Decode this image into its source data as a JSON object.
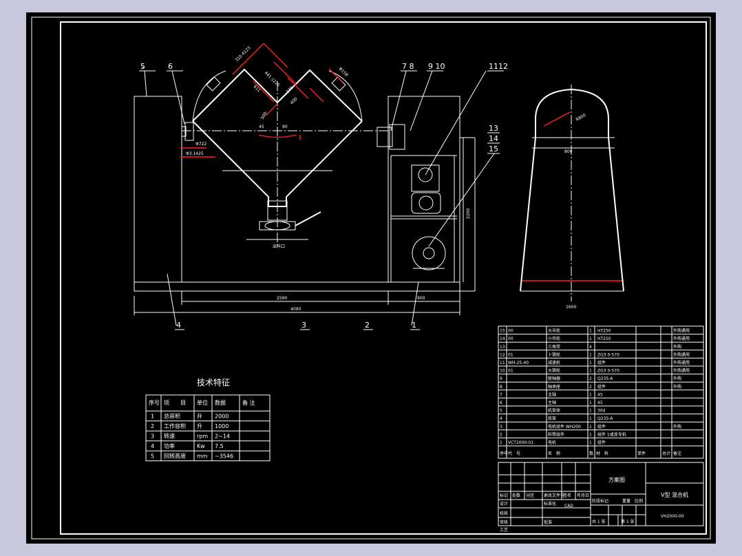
{
  "colors": {
    "background": "#000000",
    "line": "#ffffff",
    "dimension": "#ff2020",
    "outer": "#c8c8dc"
  },
  "balloons": [
    "5",
    "6",
    "7",
    "8",
    "9",
    "10",
    "1112",
    "13",
    "14",
    "15",
    "4",
    "3",
    "2",
    "1"
  ],
  "dims": {
    "d1": "310.4123",
    "d2": "441.1226",
    "d3": "611",
    "d4": "370",
    "d5": "400",
    "d6": "Φ158",
    "d7": "500",
    "d8": "90",
    "d9": "45",
    "d10": "Φ722",
    "d11": "Φ3.1425",
    "d12": "2200",
    "d13": "2590",
    "d14": "900",
    "d15": "4090",
    "d16": "R800",
    "d17": "800",
    "d18": "1600"
  },
  "outlet_label": "出料口",
  "tech": {
    "title": "技术特征",
    "headers": [
      "序号",
      "项　　目",
      "单位",
      "数据",
      "备 注"
    ],
    "rows": [
      [
        "1",
        "总容积",
        "升",
        "2000",
        ""
      ],
      [
        "2",
        "工作容积",
        "升",
        "1000",
        ""
      ],
      [
        "3",
        "转速",
        "rpm",
        "2~14",
        ""
      ],
      [
        "4",
        "功率",
        "Kw",
        "7.5",
        ""
      ],
      [
        "5",
        "回转高度",
        "mm",
        "~3546",
        ""
      ]
    ]
  },
  "bom": {
    "rows": [
      [
        "15",
        "00",
        "大吊轮",
        "1",
        "HT250",
        "",
        "外购通用"
      ],
      [
        "14",
        "00",
        "小吊轮",
        "1",
        "HT250",
        "",
        "外购通用"
      ],
      [
        "13",
        "",
        "三角带",
        "4",
        "",
        "",
        "外购"
      ],
      [
        "12",
        "01",
        "卜铸轮",
        "1",
        "ZG3 0-570",
        "",
        "外购通用"
      ],
      [
        "11",
        "WH-25-40",
        "减速机",
        "1",
        "组件",
        "",
        "外购通用"
      ],
      [
        "10",
        "01",
        "大铸轮",
        "1",
        "ZG3 0-570",
        "",
        "外购通用"
      ],
      [
        "9",
        "",
        "联轴器",
        "2",
        "Q235-A",
        "",
        "外购"
      ],
      [
        "8",
        "",
        "轴承座",
        "2",
        "组件",
        "",
        "外购"
      ],
      [
        "7",
        "",
        "主轴",
        "1",
        "45",
        "",
        ""
      ],
      [
        "6",
        "",
        "主轴",
        "1",
        "45",
        "",
        ""
      ],
      [
        "5",
        "",
        "机架体",
        "1",
        "304",
        "",
        ""
      ],
      [
        "4",
        "",
        "底架",
        "1",
        "Q235-A",
        "",
        ""
      ],
      [
        "3",
        "",
        "电机组件 WH200",
        "1",
        "组件",
        "",
        "外购"
      ],
      [
        "2",
        "",
        "料筒组件",
        "1",
        "组件 1或非专机",
        "",
        ""
      ],
      [
        "1",
        "VCT2000-01",
        "电机",
        "1",
        "组件",
        "",
        ""
      ]
    ],
    "header": [
      "序号",
      "代　号",
      "名　称",
      "数",
      "材　料",
      "单件",
      "总计",
      "备注"
    ],
    "header_sub": [
      "",
      "",
      "",
      "量",
      "",
      "重　量",
      "",
      ""
    ]
  },
  "title_block": {
    "drawing_name": "方案图",
    "product": "V型 混合机",
    "code": "VH2000-00",
    "cad": "CAD",
    "stage_label": "阶段标记",
    "weight": "重量",
    "scale": "比例",
    "sheets_total": "共  1 张",
    "sheet_no": "第  1 张",
    "rows": [
      "标记",
      "处数",
      "分区",
      "更改文件号",
      "签名",
      "年月日"
    ],
    "design": "设计",
    "std": "标准化",
    "check": "校核",
    "review": "审核",
    "craft": "工艺",
    "approve": "批准"
  }
}
